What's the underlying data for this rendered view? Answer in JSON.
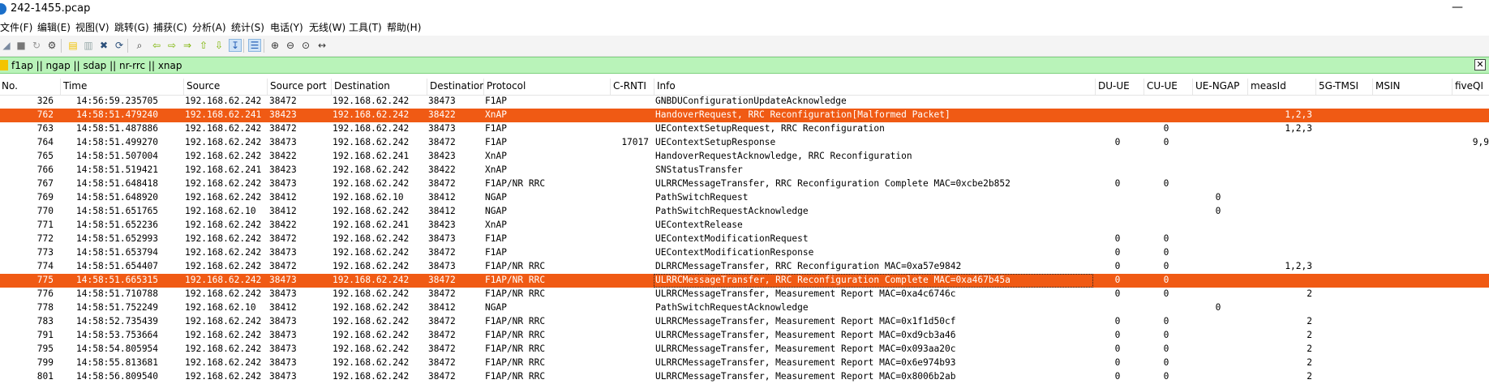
{
  "window": {
    "title": "242-1455.pcap",
    "minimize": "—"
  },
  "menu": [
    "文件(F)",
    "编辑(E)",
    "视图(V)",
    "跳转(G)",
    "捕获(C)",
    "分析(A)",
    "统计(S)",
    "电话(Y)",
    "无线(W)",
    "工具(T)",
    "帮助(H)"
  ],
  "toolbar": {
    "icons": [
      "start-capture-icon",
      "stop-capture-icon",
      "restart-capture-icon",
      "capture-options-icon",
      "open-file-icon",
      "save-file-icon",
      "close-file-icon",
      "reload-file-icon",
      "find-packet-icon",
      "go-back-icon",
      "go-forward-icon",
      "go-to-packet-icon",
      "go-first-packet-icon",
      "go-last-packet-icon",
      "autoscroll-icon",
      "colorize-icon",
      "zoom-in-icon",
      "zoom-out-icon",
      "zoom-reset-icon",
      "resize-columns-icon"
    ],
    "glyphs": [
      "◢",
      "■",
      "↻",
      "⚙",
      "▤",
      "▥",
      "✖",
      "⟳",
      "⌕",
      "⇦",
      "⇨",
      "⇒",
      "⇧",
      "⇩",
      "↧",
      "☰",
      "⊕",
      "⊖",
      "⊙",
      "↔"
    ]
  },
  "filter": {
    "value": "f1ap || ngap || sdap || nr-rrc || xnap",
    "clear": "✕"
  },
  "columns": [
    "No.",
    "Time",
    "Source",
    "Source port",
    "Destination",
    "Destination",
    "Protocol",
    "C-RNTI",
    "Info",
    "DU-UE",
    "CU-UE",
    "UE-NGAP",
    "measId",
    "5G-TMSI",
    "MSIN",
    "fiveQI"
  ],
  "colors": {
    "highlight": "#f05a14",
    "filter_ok": "#b9f3b9"
  },
  "rows": [
    {
      "no": "326",
      "time": "14:56:59.235705",
      "src": "192.168.62.242",
      "sport": "38472",
      "dst": "192.168.62.242",
      "dport": "38473",
      "proto": "F1AP",
      "crnti": "",
      "info": "GNBDUConfigurationUpdateAcknowledge",
      "du": "",
      "cu": "",
      "ngap": "",
      "meas": "",
      "fiveqi": "",
      "hl": false
    },
    {
      "no": "762",
      "time": "14:58:51.479240",
      "src": "192.168.62.241",
      "sport": "38423",
      "dst": "192.168.62.242",
      "dport": "38422",
      "proto": "XnAP",
      "crnti": "",
      "info": "HandoverRequest, RRC Reconfiguration[Malformed Packet]",
      "du": "",
      "cu": "",
      "ngap": "",
      "meas": "1,2,3",
      "fiveqi": "",
      "hl": true
    },
    {
      "no": "763",
      "time": "14:58:51.487886",
      "src": "192.168.62.242",
      "sport": "38472",
      "dst": "192.168.62.242",
      "dport": "38473",
      "proto": "F1AP",
      "crnti": "",
      "info": "UEContextSetupRequest, RRC Reconfiguration",
      "du": "",
      "cu": "0",
      "ngap": "",
      "meas": "1,2,3",
      "fiveqi": "",
      "hl": false
    },
    {
      "no": "764",
      "time": "14:58:51.499270",
      "src": "192.168.62.242",
      "sport": "38473",
      "dst": "192.168.62.242",
      "dport": "38472",
      "proto": "F1AP",
      "crnti": "17017",
      "info": "UEContextSetupResponse",
      "du": "0",
      "cu": "0",
      "ngap": "",
      "meas": "",
      "fiveqi": "9,9",
      "hl": false
    },
    {
      "no": "765",
      "time": "14:58:51.507004",
      "src": "192.168.62.242",
      "sport": "38422",
      "dst": "192.168.62.241",
      "dport": "38423",
      "proto": "XnAP",
      "crnti": "",
      "info": "HandoverRequestAcknowledge, RRC Reconfiguration",
      "du": "",
      "cu": "",
      "ngap": "",
      "meas": "",
      "fiveqi": "",
      "hl": false
    },
    {
      "no": "766",
      "time": "14:58:51.519421",
      "src": "192.168.62.241",
      "sport": "38423",
      "dst": "192.168.62.242",
      "dport": "38422",
      "proto": "XnAP",
      "crnti": "",
      "info": "SNStatusTransfer",
      "du": "",
      "cu": "",
      "ngap": "",
      "meas": "",
      "fiveqi": "",
      "hl": false
    },
    {
      "no": "767",
      "time": "14:58:51.648418",
      "src": "192.168.62.242",
      "sport": "38473",
      "dst": "192.168.62.242",
      "dport": "38472",
      "proto": "F1AP/NR RRC",
      "crnti": "",
      "info": "ULRRCMessageTransfer, RRC Reconfiguration Complete MAC=0xcbe2b852",
      "du": "0",
      "cu": "0",
      "ngap": "",
      "meas": "",
      "fiveqi": "",
      "hl": false
    },
    {
      "no": "769",
      "time": "14:58:51.648920",
      "src": "192.168.62.242",
      "sport": "38412",
      "dst": "192.168.62.10",
      "dport": "38412",
      "proto": "NGAP",
      "crnti": "",
      "info": "PathSwitchRequest",
      "du": "",
      "cu": "",
      "ngap": "0",
      "meas": "",
      "fiveqi": "",
      "hl": false
    },
    {
      "no": "770",
      "time": "14:58:51.651765",
      "src": "192.168.62.10",
      "sport": "38412",
      "dst": "192.168.62.242",
      "dport": "38412",
      "proto": "NGAP",
      "crnti": "",
      "info": "PathSwitchRequestAcknowledge",
      "du": "",
      "cu": "",
      "ngap": "0",
      "meas": "",
      "fiveqi": "",
      "hl": false
    },
    {
      "no": "771",
      "time": "14:58:51.652236",
      "src": "192.168.62.242",
      "sport": "38422",
      "dst": "192.168.62.241",
      "dport": "38423",
      "proto": "XnAP",
      "crnti": "",
      "info": "UEContextRelease",
      "du": "",
      "cu": "",
      "ngap": "",
      "meas": "",
      "fiveqi": "",
      "hl": false
    },
    {
      "no": "772",
      "time": "14:58:51.652993",
      "src": "192.168.62.242",
      "sport": "38472",
      "dst": "192.168.62.242",
      "dport": "38473",
      "proto": "F1AP",
      "crnti": "",
      "info": "UEContextModificationRequest",
      "du": "0",
      "cu": "0",
      "ngap": "",
      "meas": "",
      "fiveqi": "",
      "hl": false
    },
    {
      "no": "773",
      "time": "14:58:51.653794",
      "src": "192.168.62.242",
      "sport": "38473",
      "dst": "192.168.62.242",
      "dport": "38472",
      "proto": "F1AP",
      "crnti": "",
      "info": "UEContextModificationResponse",
      "du": "0",
      "cu": "0",
      "ngap": "",
      "meas": "",
      "fiveqi": "",
      "hl": false
    },
    {
      "no": "774",
      "time": "14:58:51.654407",
      "src": "192.168.62.242",
      "sport": "38472",
      "dst": "192.168.62.242",
      "dport": "38473",
      "proto": "F1AP/NR RRC",
      "crnti": "",
      "info": "DLRRCMessageTransfer, RRC Reconfiguration MAC=0xa57e9842",
      "du": "0",
      "cu": "0",
      "ngap": "",
      "meas": "1,2,3",
      "fiveqi": "",
      "hl": false
    },
    {
      "no": "775",
      "time": "14:58:51.665315",
      "src": "192.168.62.242",
      "sport": "38473",
      "dst": "192.168.62.242",
      "dport": "38472",
      "proto": "F1AP/NR RRC",
      "crnti": "",
      "info": "ULRRCMessageTransfer, RRC Reconfiguration Complete MAC=0xa467b45a",
      "du": "0",
      "cu": "0",
      "ngap": "",
      "meas": "",
      "fiveqi": "",
      "hl": true
    },
    {
      "no": "776",
      "time": "14:58:51.710788",
      "src": "192.168.62.242",
      "sport": "38473",
      "dst": "192.168.62.242",
      "dport": "38472",
      "proto": "F1AP/NR RRC",
      "crnti": "",
      "info": "ULRRCMessageTransfer, Measurement Report MAC=0xa4c6746c",
      "du": "0",
      "cu": "0",
      "ngap": "",
      "meas": "2",
      "fiveqi": "",
      "hl": false
    },
    {
      "no": "778",
      "time": "14:58:51.752249",
      "src": "192.168.62.10",
      "sport": "38412",
      "dst": "192.168.62.242",
      "dport": "38412",
      "proto": "NGAP",
      "crnti": "",
      "info": "PathSwitchRequestAcknowledge",
      "du": "",
      "cu": "",
      "ngap": "0",
      "meas": "",
      "fiveqi": "",
      "hl": false
    },
    {
      "no": "783",
      "time": "14:58:52.735439",
      "src": "192.168.62.242",
      "sport": "38473",
      "dst": "192.168.62.242",
      "dport": "38472",
      "proto": "F1AP/NR RRC",
      "crnti": "",
      "info": "ULRRCMessageTransfer, Measurement Report MAC=0x1f1d50cf",
      "du": "0",
      "cu": "0",
      "ngap": "",
      "meas": "2",
      "fiveqi": "",
      "hl": false
    },
    {
      "no": "791",
      "time": "14:58:53.753664",
      "src": "192.168.62.242",
      "sport": "38473",
      "dst": "192.168.62.242",
      "dport": "38472",
      "proto": "F1AP/NR RRC",
      "crnti": "",
      "info": "ULRRCMessageTransfer, Measurement Report MAC=0xd9cb3a46",
      "du": "0",
      "cu": "0",
      "ngap": "",
      "meas": "2",
      "fiveqi": "",
      "hl": false
    },
    {
      "no": "795",
      "time": "14:58:54.805954",
      "src": "192.168.62.242",
      "sport": "38473",
      "dst": "192.168.62.242",
      "dport": "38472",
      "proto": "F1AP/NR RRC",
      "crnti": "",
      "info": "ULRRCMessageTransfer, Measurement Report MAC=0x093aa20c",
      "du": "0",
      "cu": "0",
      "ngap": "",
      "meas": "2",
      "fiveqi": "",
      "hl": false
    },
    {
      "no": "799",
      "time": "14:58:55.813681",
      "src": "192.168.62.242",
      "sport": "38473",
      "dst": "192.168.62.242",
      "dport": "38472",
      "proto": "F1AP/NR RRC",
      "crnti": "",
      "info": "ULRRCMessageTransfer, Measurement Report MAC=0x6e974b93",
      "du": "0",
      "cu": "0",
      "ngap": "",
      "meas": "2",
      "fiveqi": "",
      "hl": false
    },
    {
      "no": "801",
      "time": "14:58:56.809540",
      "src": "192.168.62.242",
      "sport": "38473",
      "dst": "192.168.62.242",
      "dport": "38472",
      "proto": "F1AP/NR RRC",
      "crnti": "",
      "info": "ULRRCMessageTransfer, Measurement Report MAC=0x8006b2ab",
      "du": "0",
      "cu": "0",
      "ngap": "",
      "meas": "2",
      "fiveqi": "",
      "hl": false
    }
  ]
}
